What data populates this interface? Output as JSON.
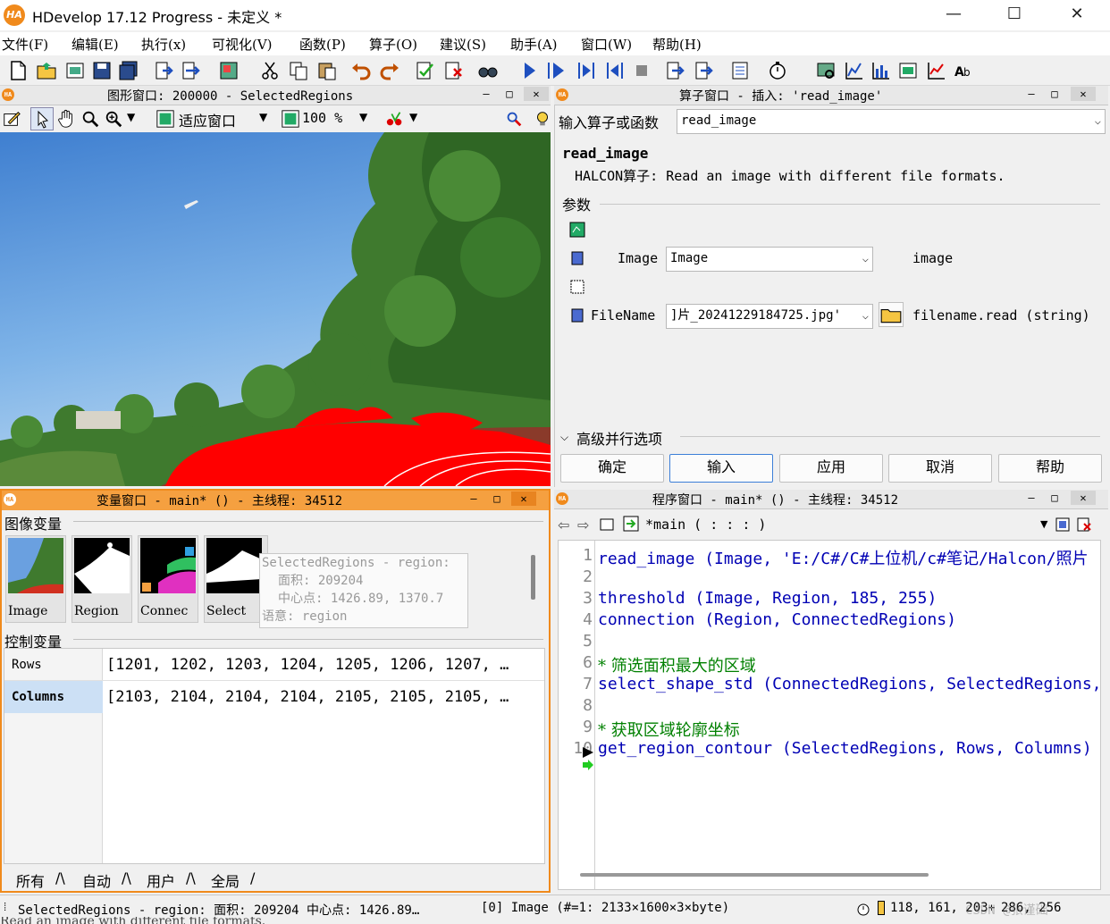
{
  "app": {
    "logo": "HA",
    "title": "HDevelop 17.12 Progress - 未定义 *",
    "minimize": "—",
    "maximize": "☐",
    "close": "✕"
  },
  "menu": [
    "文件(F)",
    "编辑(E)",
    "执行(x)",
    "可视化(V)",
    "函数(P)",
    "算子(O)",
    "建议(S)",
    "助手(A)",
    "窗口(W)",
    "帮助(H)"
  ],
  "graphics_window": {
    "title": "图形窗口: 200000 - SelectedRegions",
    "fit_label": "适应窗口",
    "zoom_label": "100 %"
  },
  "operator_window": {
    "title": "算子窗口 - 插入: 'read_image'",
    "input_label": "输入算子或函数",
    "input_value": "read_image",
    "op_name": "read_image",
    "op_desc": "HALCON算子: Read an image with different file formats.",
    "params_label": "参数",
    "param1_name": "Image",
    "param1_value": "Image",
    "param1_type": "image",
    "param2_name": "FileName",
    "param2_value": "]片_20241229184725.jpg'",
    "param2_type": "filename.read (string)",
    "advanced_label": "高级并行选项",
    "buttons": {
      "ok": "确定",
      "enter": "输入",
      "apply": "应用",
      "cancel": "取消",
      "help": "帮助"
    }
  },
  "variable_window": {
    "title": "变量窗口 - main* () - 主线程: 34512",
    "iconic_label": "图像变量",
    "control_label": "控制变量",
    "thumbs": [
      "Image",
      "Region",
      "Connec",
      "Select"
    ],
    "tooltip": {
      "line1": "SelectedRegions - region:",
      "line2": "面积: 209204",
      "line3": "中心点: 1426.89, 1370.7",
      "line4": "语意: region"
    },
    "control_vars": [
      {
        "name": "Rows",
        "value": "[1201, 1202, 1203, 1204, 1205, 1206, 1207, …"
      },
      {
        "name": "Columns",
        "value": "[2103, 2104, 2104, 2104, 2105, 2105, 2105, …"
      }
    ],
    "tabs": [
      "所有",
      "自动",
      "用户",
      "全局"
    ]
  },
  "program_window": {
    "title": "程序窗口 - main* () - 主线程: 34512",
    "proc_label": "*main ( : : : )",
    "lines": [
      {
        "n": "1",
        "text": "read_image (Image, 'E:/C#/C#上位机/c#笔记/Halcon/照片",
        "type": "code"
      },
      {
        "n": "2",
        "text": "",
        "type": "code"
      },
      {
        "n": "3",
        "text": "threshold (Image, Region, 185, 255)",
        "type": "code"
      },
      {
        "n": "4",
        "text": "connection (Region, ConnectedRegions)",
        "type": "code"
      },
      {
        "n": "5",
        "text": "",
        "type": "code"
      },
      {
        "n": "6",
        "text": "*  筛选面积最大的区域",
        "type": "comment"
      },
      {
        "n": "7",
        "text": "select_shape_std (ConnectedRegions, SelectedRegions,",
        "type": "code"
      },
      {
        "n": "8",
        "text": "",
        "type": "code"
      },
      {
        "n": "9",
        "text": "*  获取区域轮廓坐标",
        "type": "comment"
      },
      {
        "n": "10",
        "text": "get_region_contour (SelectedRegions, Rows, Columns)",
        "type": "code"
      }
    ]
  },
  "status": {
    "left": "SelectedRegions - region: 面积: 209204 中心点: 1426.89…",
    "middle": "[0] Image (#=1: 2133×1600×3×byte)",
    "pixel": "118, 161, 203",
    "coords": "286, 256",
    "watermark": "CSDN @张谨础",
    "underline": "Read an image with different file formats."
  },
  "colors": {
    "accent": "#f08a1c",
    "keyword": "#0000b4",
    "comment": "#008000",
    "region_red": "#ff0000"
  }
}
